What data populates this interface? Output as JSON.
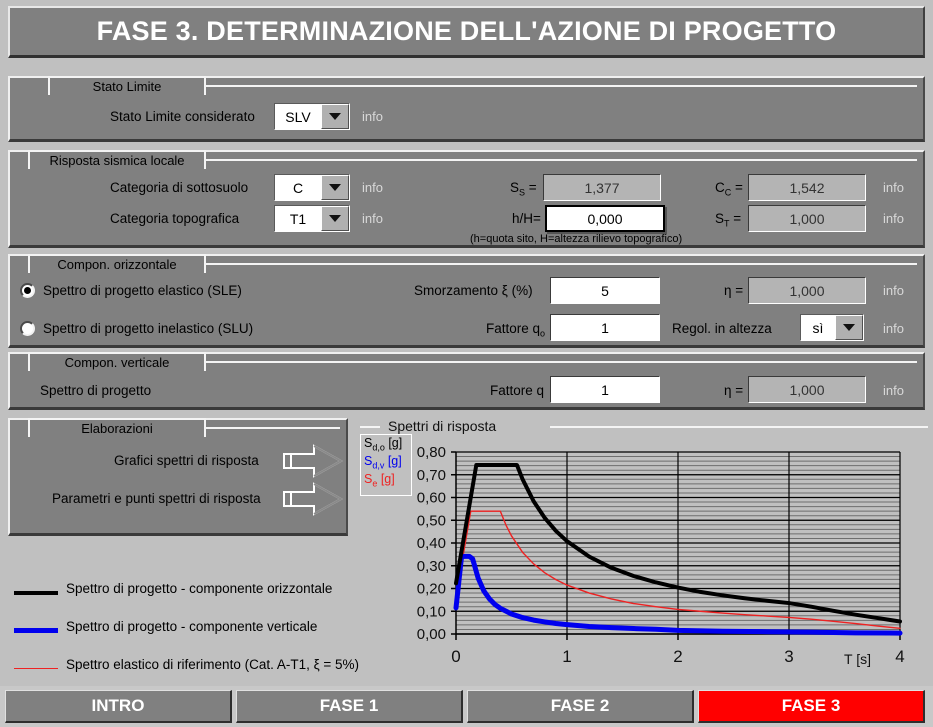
{
  "header": {
    "title": "FASE 3. DETERMINAZIONE DELL'AZIONE DI PROGETTO"
  },
  "stato_limite": {
    "group_title": "Stato  Limite",
    "label": "Stato Limite considerato",
    "value": "SLV",
    "info": "info"
  },
  "risposta": {
    "group_title": "Risposta  sismica locale",
    "row1_label": "Categoria di sottosuolo",
    "row1_value": "C",
    "row1_info": "info",
    "row2_label": "Categoria topografica",
    "row2_value": "T1",
    "row2_info": "info",
    "ss_label": "S",
    "ss_sub": "S",
    "ss_eq": " =",
    "ss_value": "1,377",
    "cc_label": "C",
    "cc_sub": "C",
    "cc_eq": " =",
    "cc_value": "1,542",
    "cc_info": "info",
    "hh_label": "h/H=",
    "hh_value": "0,000",
    "hh_note": "(h=quota sito, H=altezza rilievo topografico)",
    "st_label": "S",
    "st_sub": "T",
    "st_eq": " =",
    "st_value": "1,000",
    "st_info": "info"
  },
  "orizzontale": {
    "group_title": "Compon.  orizzontale",
    "opt1_label": "Spettro  di  progetto  elastico  (SLE)",
    "opt1_selected": true,
    "opt2_label": "Spettro  di  progetto  inelastico  (SLU)",
    "opt2_selected": false,
    "smorz_label": "Smorzamento  ξ (%)",
    "smorz_value": "5",
    "eta_label": "η =",
    "eta_value": "1,000",
    "eta_info": "info",
    "q0_label": "Fattore q",
    "q0_sub": "o",
    "q0_value": "1",
    "regol_label": "Regol. in altezza",
    "regol_value": "sì",
    "regol_info": "info"
  },
  "verticale": {
    "group_title": "Compon.  verticale",
    "label": "Spettro di progetto",
    "q_label": "Fattore q",
    "q_value": "1",
    "eta_label": "η =",
    "eta_value": "1,000",
    "eta_info": "info"
  },
  "elaborazioni": {
    "group_title": "Elaborazioni",
    "btn1_label": "Grafici  spettri  di  risposta",
    "btn2_label": "Parametri  e punti  spettri  di  risposta"
  },
  "legend_bottom": {
    "items": [
      {
        "color": "#000000",
        "thick": 4,
        "text": "Spettro di progetto - componente orizzontale"
      },
      {
        "color": "#0000ee",
        "thick": 5,
        "text": "Spettro di progetto - componente verticale"
      },
      {
        "color": "#ee2222",
        "thick": 1,
        "text": "Spettro elastico di riferimento (Cat. A-T1, ξ = 5%)"
      }
    ]
  },
  "tabs": {
    "items": [
      {
        "label": "INTRO",
        "active": false
      },
      {
        "label": "FASE 1",
        "active": false
      },
      {
        "label": "FASE 2",
        "active": false
      },
      {
        "label": "FASE 3",
        "active": true
      }
    ]
  },
  "chart_data": {
    "type": "line",
    "title": "Spettri  di  risposta",
    "xlabel": "T [s]",
    "ylabel": "",
    "xlim": [
      0,
      4
    ],
    "ylim": [
      0,
      0.8
    ],
    "grid": true,
    "xticks": [
      "0",
      "1",
      "2",
      "3",
      "4"
    ],
    "yticks": [
      "0,00",
      "0,10",
      "0,20",
      "0,30",
      "0,40",
      "0,50",
      "0,60",
      "0,70",
      "0,80"
    ],
    "legend_position": "left-inside",
    "legend_entries": [
      {
        "label": "S",
        "sub": "d,o",
        "unit": " [g]",
        "color": "#000000"
      },
      {
        "label": "S",
        "sub": "d,v",
        "unit": " [g]",
        "color": "#0000ee"
      },
      {
        "label": "S",
        "sub": "e",
        "unit": " [g]",
        "color": "#ee2222"
      }
    ],
    "series": [
      {
        "name": "Sd,o",
        "color": "#000000",
        "width": 4,
        "x": [
          0.0,
          0.05,
          0.1,
          0.15,
          0.183,
          0.25,
          0.35,
          0.45,
          0.549,
          0.6,
          0.7,
          0.8,
          0.9,
          1.0,
          1.2,
          1.4,
          1.6,
          1.8,
          2.0,
          2.2,
          2.4,
          2.6,
          2.8,
          3.0,
          3.2,
          3.4,
          3.6,
          3.8,
          4.0
        ],
        "y": [
          0.223,
          0.365,
          0.507,
          0.649,
          0.743,
          0.743,
          0.743,
          0.743,
          0.743,
          0.68,
          0.583,
          0.51,
          0.453,
          0.408,
          0.34,
          0.291,
          0.255,
          0.227,
          0.204,
          0.185,
          0.17,
          0.157,
          0.146,
          0.136,
          0.12,
          0.102,
          0.085,
          0.07,
          0.055
        ]
      },
      {
        "name": "Sd,v",
        "color": "#0000ee",
        "width": 5,
        "x": [
          0.0,
          0.02,
          0.04,
          0.05,
          0.08,
          0.12,
          0.15,
          0.2,
          0.25,
          0.3,
          0.35,
          0.4,
          0.5,
          0.6,
          0.7,
          0.8,
          0.9,
          1.0,
          1.2,
          1.4,
          1.6,
          1.8,
          2.0,
          2.4,
          2.8,
          3.2,
          3.6,
          4.0
        ],
        "y": [
          0.115,
          0.205,
          0.295,
          0.34,
          0.341,
          0.341,
          0.33,
          0.245,
          0.19,
          0.155,
          0.13,
          0.113,
          0.088,
          0.072,
          0.061,
          0.053,
          0.046,
          0.041,
          0.033,
          0.028,
          0.024,
          0.021,
          0.016,
          0.012,
          0.01,
          0.008,
          0.005,
          0.004
        ]
      },
      {
        "name": "Se",
        "color": "#ee2222",
        "width": 1.4,
        "x": [
          0.0,
          0.03,
          0.06,
          0.09,
          0.12,
          0.133,
          0.2,
          0.3,
          0.399,
          0.45,
          0.5,
          0.6,
          0.7,
          0.8,
          0.9,
          1.0,
          1.2,
          1.4,
          1.6,
          1.8,
          2.0,
          2.2,
          2.4,
          2.6,
          2.8,
          3.0,
          3.2,
          3.4,
          3.6,
          3.8,
          4.0
        ],
        "y": [
          0.162,
          0.247,
          0.333,
          0.418,
          0.503,
          0.54,
          0.54,
          0.54,
          0.54,
          0.479,
          0.431,
          0.359,
          0.308,
          0.269,
          0.239,
          0.215,
          0.18,
          0.154,
          0.134,
          0.12,
          0.108,
          0.1,
          0.092,
          0.085,
          0.079,
          0.073,
          0.065,
          0.056,
          0.046,
          0.035,
          0.025
        ]
      }
    ]
  }
}
